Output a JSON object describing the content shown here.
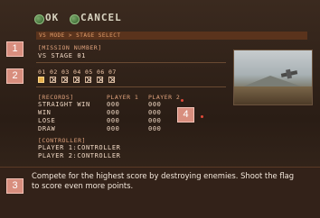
{
  "topbar": {
    "ok_label": "OK",
    "cancel_label": "CANCEL",
    "ok_icon": "circle-button-icon",
    "cancel_icon": "circle-button-icon"
  },
  "breadcrumb": "VS MODE > STAGE SELECT",
  "mission": {
    "header": "[MISSION NUMBER]",
    "value": "VS STAGE 01"
  },
  "stages": {
    "numbers": [
      "01",
      "02",
      "03",
      "04",
      "05",
      "06",
      "07"
    ],
    "selected_index": 0
  },
  "records": {
    "header": "[RECORDS]",
    "player1_label": "PLAYER 1",
    "player2_label": "PLAYER 2",
    "rows": [
      {
        "label": "STRAIGHT WIN",
        "p1": "000",
        "p2": "000"
      },
      {
        "label": "WIN",
        "p1": "000",
        "p2": "000"
      },
      {
        "label": "LOSE",
        "p1": "000",
        "p2": "000"
      },
      {
        "label": "DRAW",
        "p1": "000",
        "p2": "000"
      }
    ]
  },
  "controller": {
    "header": "[CONTROLLER]",
    "p1": "PLAYER 1:CONTROLLER",
    "p2": "PLAYER 2:CONTROLLER"
  },
  "description": "Compete for the highest score by destroying enemies. Shoot the flag to score even more points.",
  "callouts": [
    "1",
    "2",
    "3",
    "4"
  ],
  "colors": {
    "accent": "#e0a27c",
    "callout": "#d88e7e",
    "selected": "#e7b04d"
  }
}
